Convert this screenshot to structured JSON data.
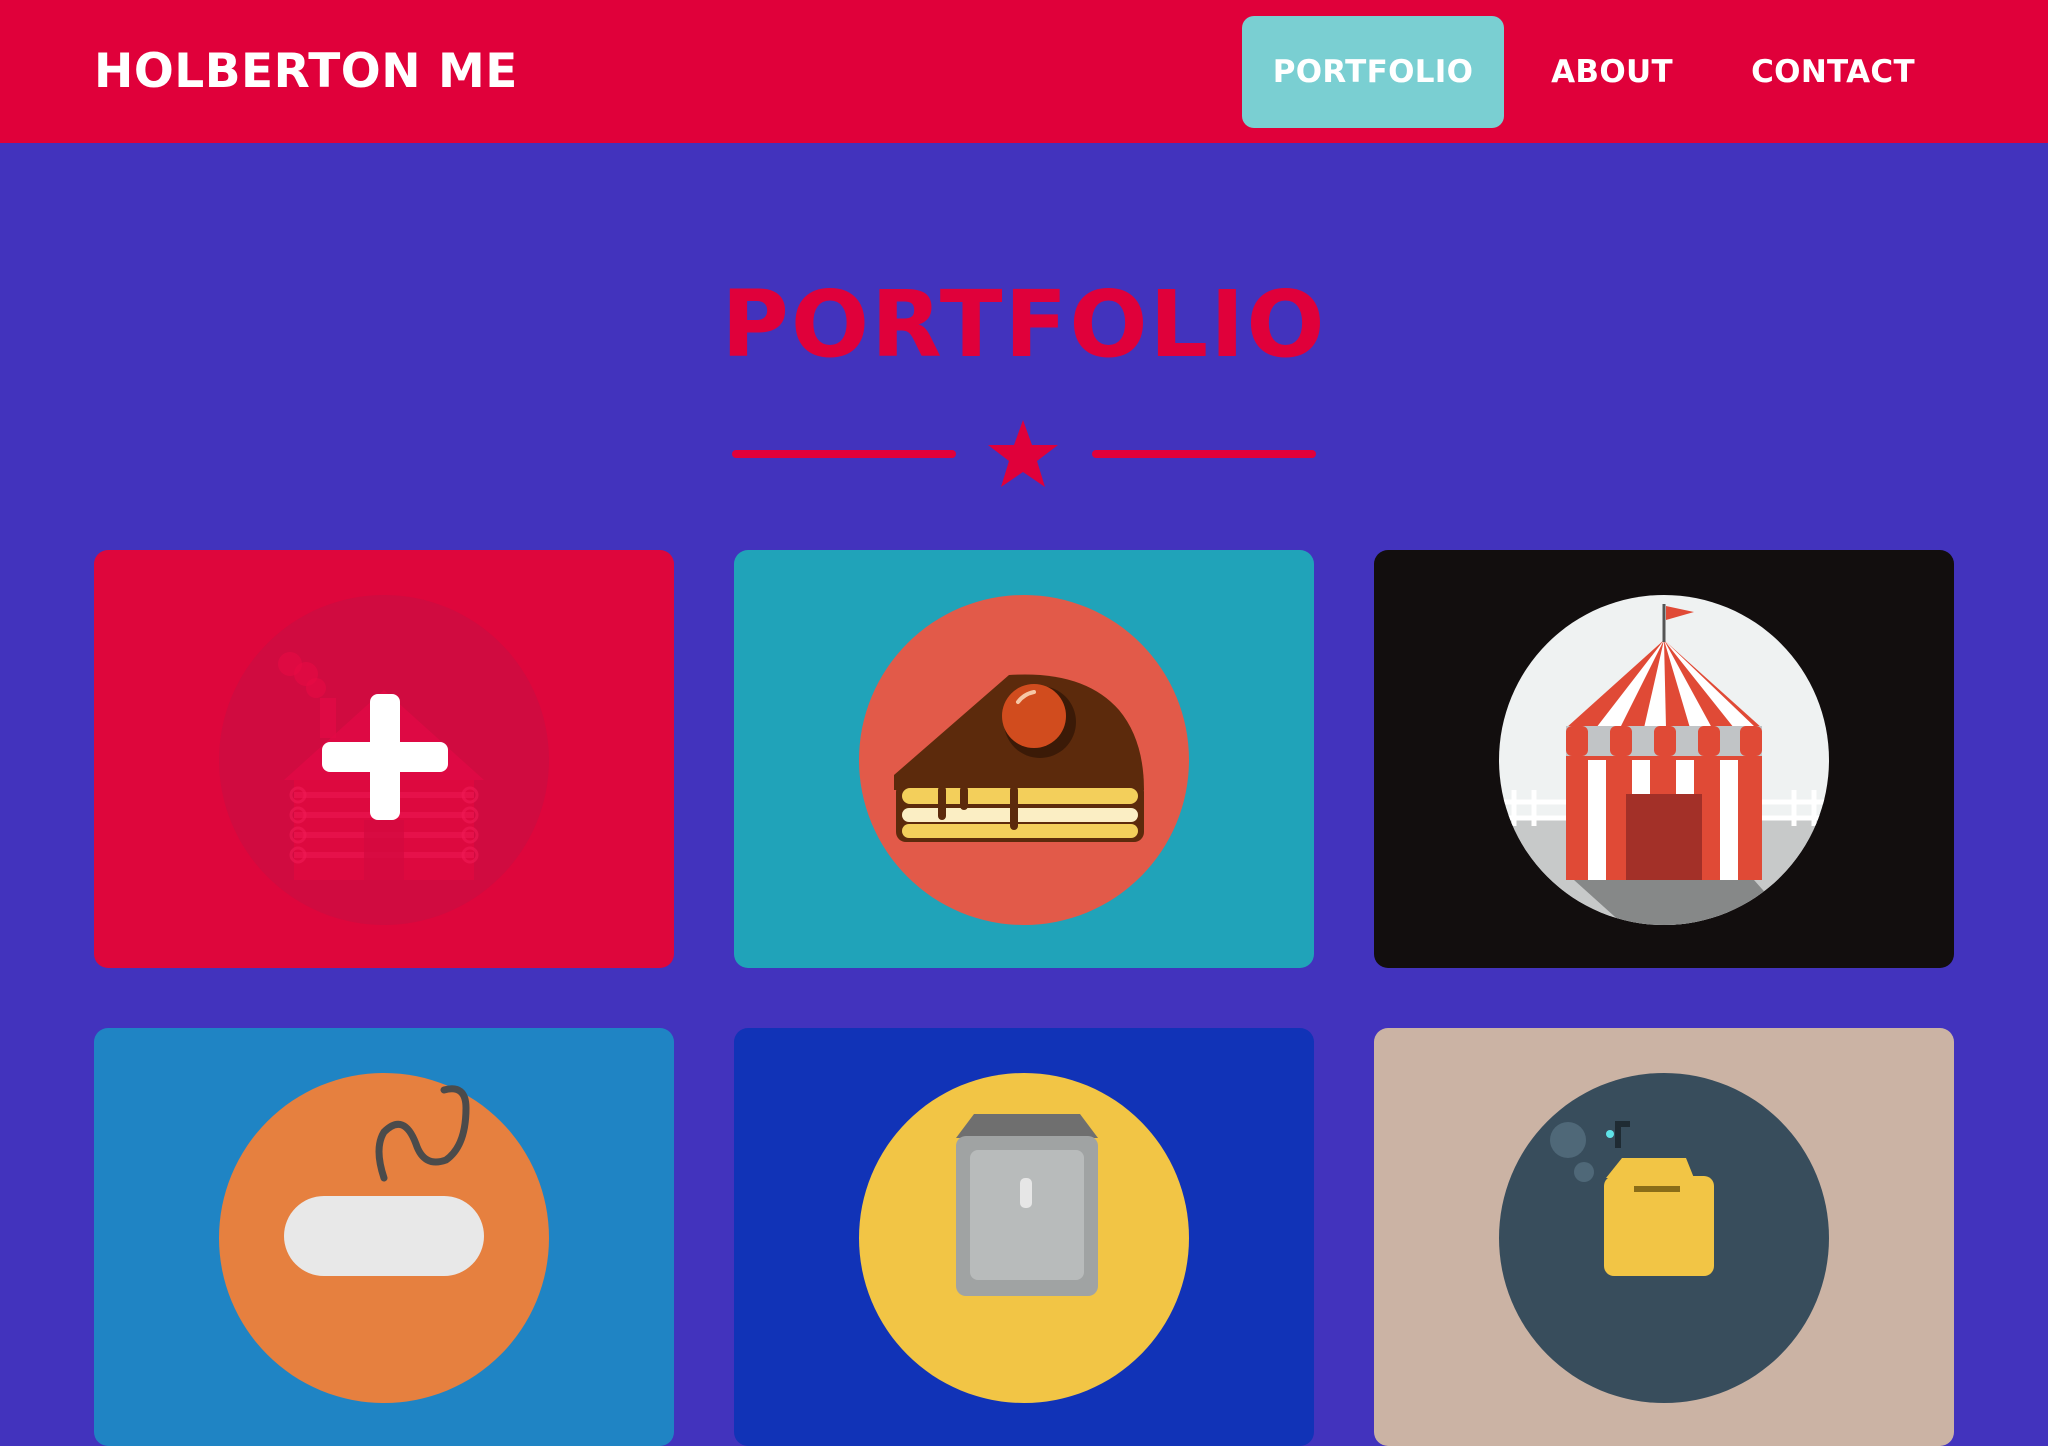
{
  "navbar": {
    "brand": "HOLBERTON ME",
    "items": [
      {
        "label": "PORTFOLIO",
        "active": true
      },
      {
        "label": "ABOUT",
        "active": false
      },
      {
        "label": "CONTACT",
        "active": false
      }
    ]
  },
  "portfolio": {
    "title": "PORTFOLIO",
    "divider_icon": "star-icon",
    "items": [
      {
        "icon": "cabin-icon",
        "background": "#de063c",
        "hovered": true,
        "overlay_icon": "plus-icon"
      },
      {
        "icon": "cake-icon",
        "background": "#20a3b9"
      },
      {
        "icon": "circus-tent-icon",
        "background": "#120e0e"
      },
      {
        "icon": "game-controller-icon",
        "background": "#1f84c4"
      },
      {
        "icon": "safe-icon",
        "background": "#1133b7"
      },
      {
        "icon": "submarine-icon",
        "background": "#cbb3a4"
      }
    ]
  },
  "colors": {
    "primary": "#e0003a",
    "background": "#4233bd",
    "active_nav": "#7acfd2",
    "text_light": "#ffffff"
  }
}
